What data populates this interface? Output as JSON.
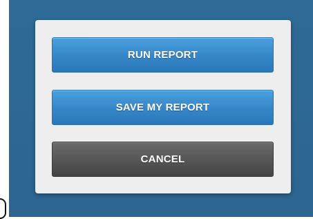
{
  "dialog": {
    "buttons": {
      "run_report": "RUN REPORT",
      "save_my_report": "SAVE MY REPORT",
      "cancel": "CANCEL"
    }
  },
  "colors": {
    "backdrop": "#2f6a96",
    "dialog_bg": "#eeeeee",
    "primary_button": "#3586c8",
    "cancel_button": "#555555"
  }
}
